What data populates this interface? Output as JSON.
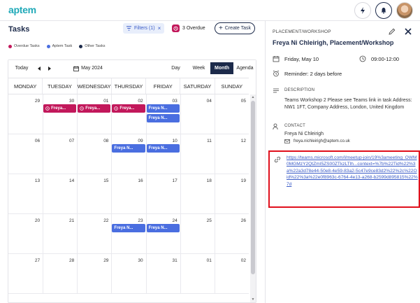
{
  "app": {
    "logo": "aptem"
  },
  "header": {
    "title": "Tasks",
    "filters_label": "Filters (1)",
    "overdue_label": "3 Overdue",
    "create_label": "Create Task"
  },
  "legend": [
    {
      "label": "Overdue Tasks",
      "color": "#c2185b"
    },
    {
      "label": "Aptem Task",
      "color": "#4a6ee0"
    },
    {
      "label": "Other Tasks",
      "color": "#1c2a4a"
    }
  ],
  "calendar": {
    "today_label": "Today",
    "current_period": "May 2024",
    "views": [
      "Day",
      "Week",
      "Month",
      "Agenda"
    ],
    "active_view": "Month",
    "weekdays": [
      "MONDAY",
      "TUESDAY",
      "WEDNESDAY",
      "THURSDAY",
      "FRIDAY",
      "SATURDAY",
      "SUNDAY"
    ],
    "weeks": [
      [
        "29",
        "30",
        "01",
        "02",
        "03",
        "04",
        "05"
      ],
      [
        "06",
        "07",
        "08",
        "09",
        "10",
        "11",
        "12"
      ],
      [
        "13",
        "14",
        "15",
        "16",
        "17",
        "18",
        "19"
      ],
      [
        "20",
        "21",
        "22",
        "23",
        "24",
        "25",
        "26"
      ],
      [
        "27",
        "28",
        "29",
        "30",
        "31",
        "01",
        "02"
      ]
    ],
    "events": [
      {
        "week": 0,
        "day": 1,
        "slot": 0,
        "kind": "overdue",
        "label": "Freya..."
      },
      {
        "week": 0,
        "day": 2,
        "slot": 0,
        "kind": "overdue",
        "label": "Freya..."
      },
      {
        "week": 0,
        "day": 3,
        "slot": 0,
        "kind": "overdue",
        "label": "Freya..."
      },
      {
        "week": 0,
        "day": 4,
        "slot": 0,
        "kind": "aptem",
        "label": "Freya N..."
      },
      {
        "week": 0,
        "day": 4,
        "slot": 1,
        "kind": "aptem",
        "label": "Freya N..."
      },
      {
        "week": 1,
        "day": 3,
        "slot": 0,
        "kind": "aptem",
        "label": "Freya N..."
      },
      {
        "week": 1,
        "day": 4,
        "slot": 0,
        "kind": "aptem",
        "label": "Freya N..."
      },
      {
        "week": 3,
        "day": 3,
        "slot": 0,
        "kind": "aptem",
        "label": "Freya N..."
      },
      {
        "week": 3,
        "day": 4,
        "slot": 0,
        "kind": "aptem",
        "label": "Freya N..."
      }
    ]
  },
  "detail": {
    "type": "PLACEMENT/WORKSHOP",
    "title": "Freya Ni Chleirigh, Placement/Workshop",
    "date": "Friday, May 10",
    "time": "09:00-12:00",
    "reminder": "Reminder: 2 days before",
    "description_label": "DESCRIPTION",
    "description": "Teams Workshop 2 Please see Teams link in task Address: NW1 1FT, Company Address, London, United Kingdom",
    "contact_label": "CONTACT",
    "contact_name": "Freya Ni Chleirigh",
    "contact_email": "freya.nichleirigh@aptem.co.uk",
    "link": "https://teams.microsoft.com/l/meetup-join/19%3ameeting_OWM0MGMzY2QtZmI5ZS00ZTkzLTlh...context=%7b%22Tid%22%3a%22a3d78e44-50e8-4e59-83a2-5c47e9ce83d2%22%2c%22Oid%22%3a%22e0f8963c-6764-4e13-a268-b2599d895815%22%7d"
  }
}
